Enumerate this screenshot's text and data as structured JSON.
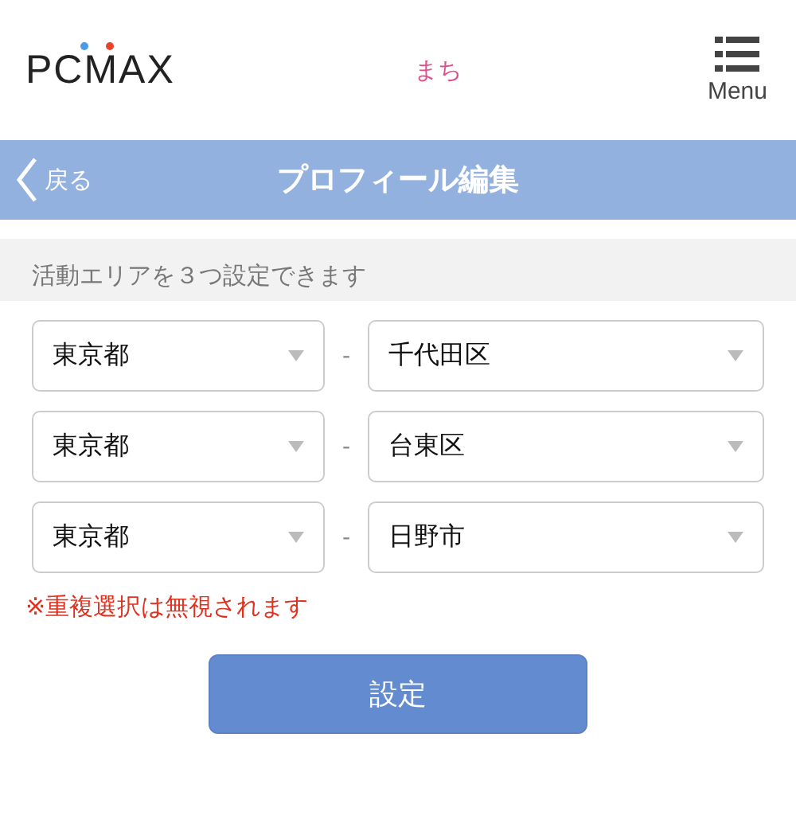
{
  "header": {
    "logo": "PCMAX",
    "username": "まち",
    "menu_label": "Menu"
  },
  "nav_bar": {
    "back_label": "戻る",
    "title": "プロフィール編集"
  },
  "section_note": "活動エリアを３つ設定できます",
  "areas": [
    {
      "prefecture": "東京都",
      "separator": "-",
      "city": "千代田区"
    },
    {
      "prefecture": "東京都",
      "separator": "-",
      "city": "台東区"
    },
    {
      "prefecture": "東京都",
      "separator": "-",
      "city": "日野市"
    }
  ],
  "warning": "※重複選択は無視されます",
  "submit_label": "設定"
}
